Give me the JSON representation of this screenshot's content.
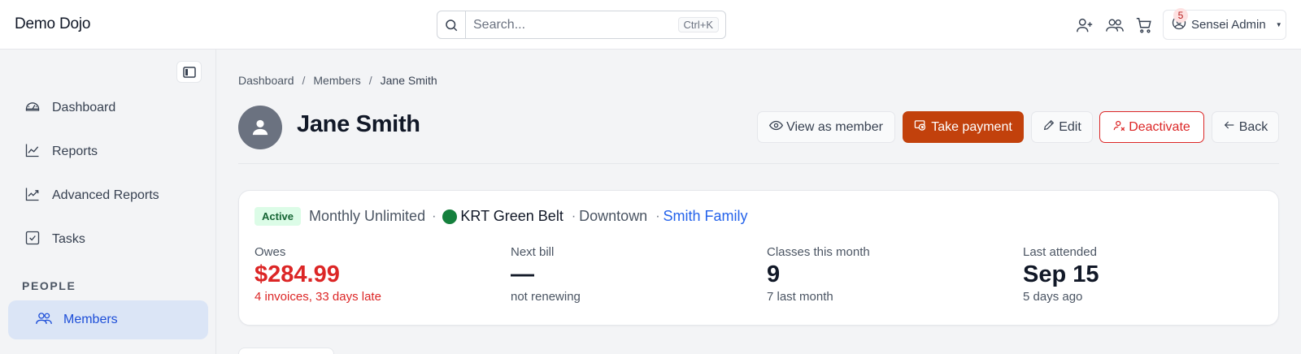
{
  "header": {
    "brand": "Demo Dojo",
    "search_placeholder": "Search...",
    "search_shortcut": "Ctrl+K",
    "notification_count": "5",
    "user_name": "Sensei Admin"
  },
  "sidebar": {
    "items": [
      {
        "label": "Dashboard",
        "icon": "gauge-icon"
      },
      {
        "label": "Reports",
        "icon": "line-chart-icon"
      },
      {
        "label": "Advanced Reports",
        "icon": "trend-chart-icon"
      },
      {
        "label": "Tasks",
        "icon": "checkbox-icon"
      }
    ],
    "section_people": "PEOPLE",
    "members_label": "Members"
  },
  "breadcrumb": {
    "items": [
      "Dashboard",
      "Members",
      "Jane Smith"
    ],
    "separator": "/"
  },
  "member": {
    "name": "Jane Smith"
  },
  "actions": {
    "view_as_member": "View as member",
    "take_payment": "Take payment",
    "edit": "Edit",
    "deactivate": "Deactivate",
    "back": "Back"
  },
  "summary": {
    "status": "Active",
    "plan": "Monthly Unlimited",
    "belt": "KRT Green Belt",
    "location": "Downtown",
    "family": "Smith Family",
    "separator": "·"
  },
  "stats": {
    "owes": {
      "label": "Owes",
      "value": "$284.99",
      "sub": "4 invoices, 33 days late"
    },
    "next_bill": {
      "label": "Next bill",
      "value": "—",
      "sub": "not renewing"
    },
    "classes": {
      "label": "Classes this month",
      "value": "9",
      "sub": "7 last month"
    },
    "last_attended": {
      "label": "Last attended",
      "value": "Sep 15",
      "sub": "5 days ago"
    }
  },
  "colors": {
    "primary": "#c2410c",
    "danger": "#dc2626",
    "link": "#2563eb",
    "active_nav_bg": "#dbe5f6",
    "belt_green": "#15803d"
  }
}
